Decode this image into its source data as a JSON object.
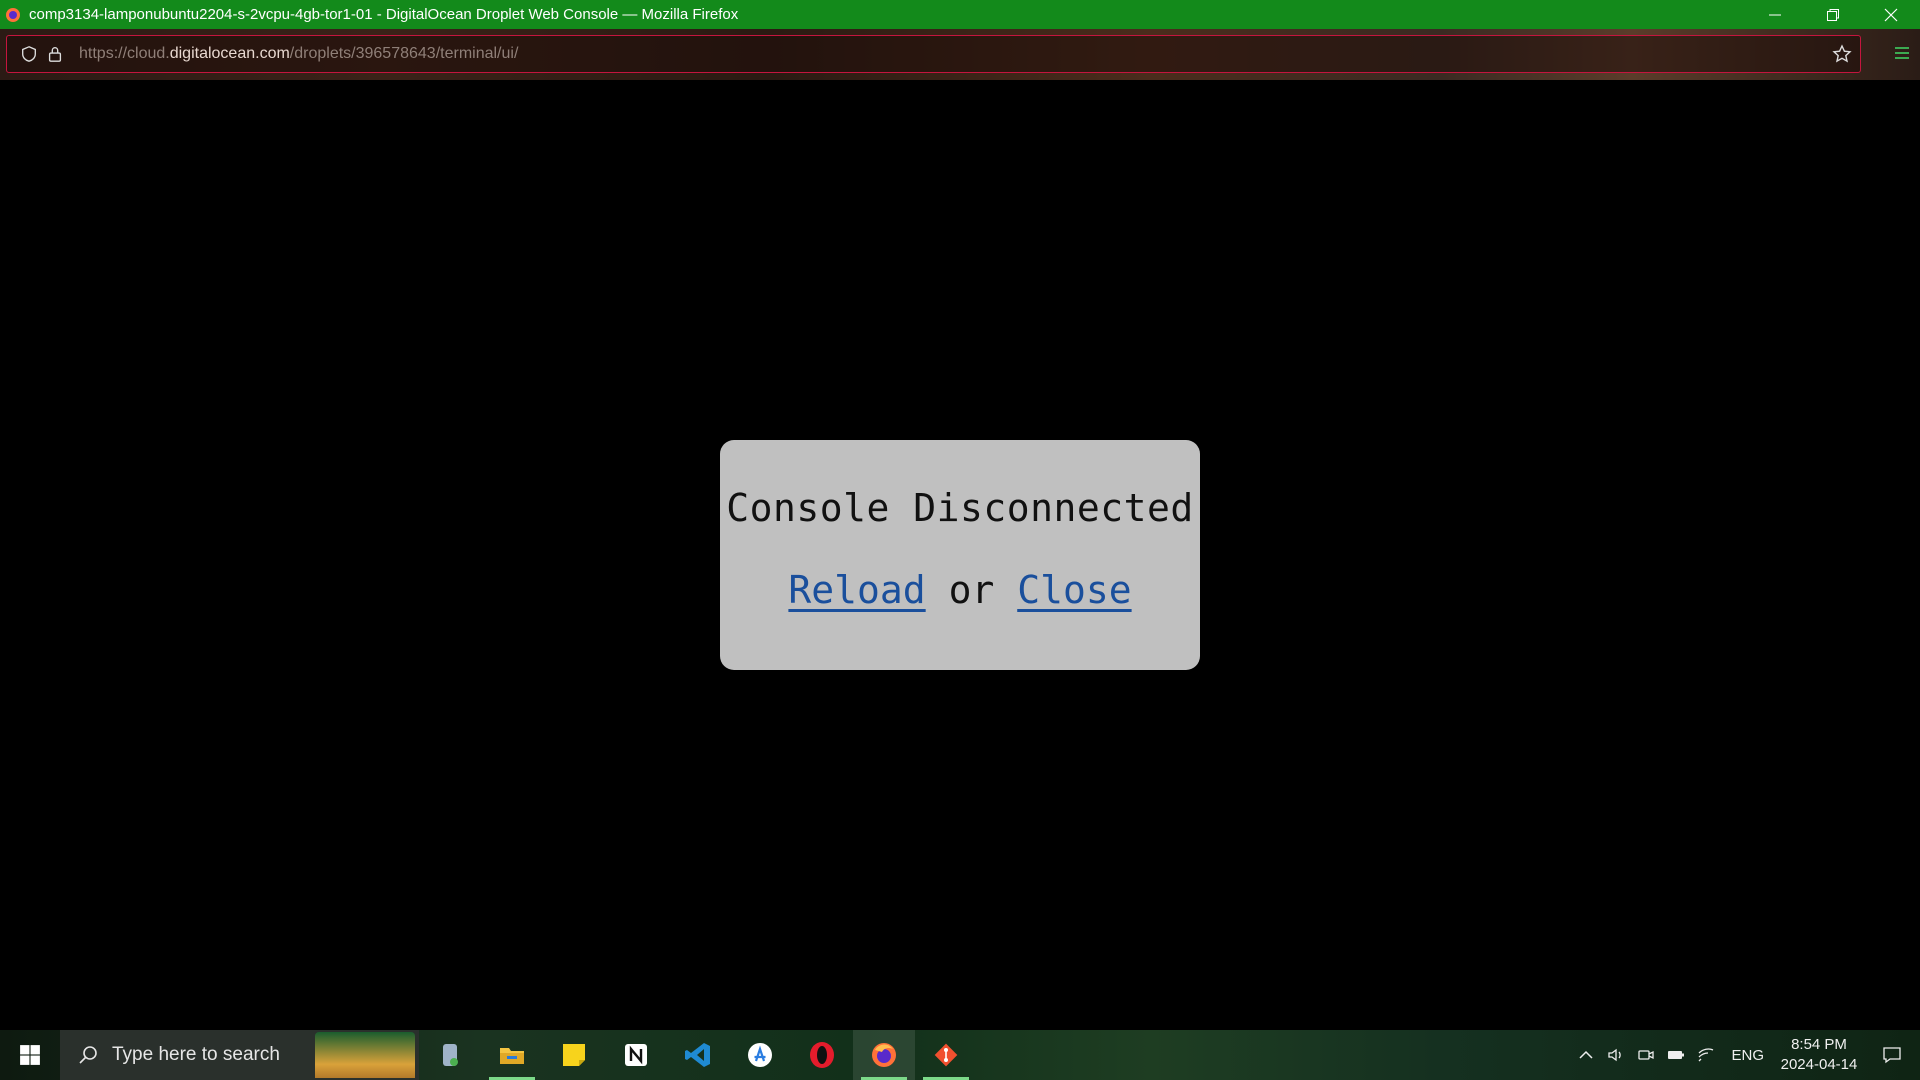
{
  "window": {
    "title": "comp3134-lamponubuntu2204-s-2vcpu-4gb-tor1-01 - DigitalOcean Droplet Web Console — Mozilla Firefox"
  },
  "urlbar": {
    "prefix": "https://cloud.",
    "host": "digitalocean.com",
    "path": "/droplets/396578643/terminal/ui/"
  },
  "dialog": {
    "heading": "Console Disconnected",
    "reload_label": "Reload",
    "or_text": "or",
    "close_label": "Close"
  },
  "taskbar": {
    "search_placeholder": "Type here to search",
    "apps": [
      "file-drive-icon",
      "file-explorer-icon",
      "sticky-notes-icon",
      "notion-icon",
      "vscode-icon",
      "app-store-icon",
      "opera-icon",
      "firefox-icon",
      "git-icon"
    ],
    "lang": "ENG",
    "time": "8:54 PM",
    "date": "2024-04-14"
  },
  "colors": {
    "titlebar": "#138a1b",
    "link": "#1a4f9c",
    "dialog_bg": "#c0c0c0"
  }
}
